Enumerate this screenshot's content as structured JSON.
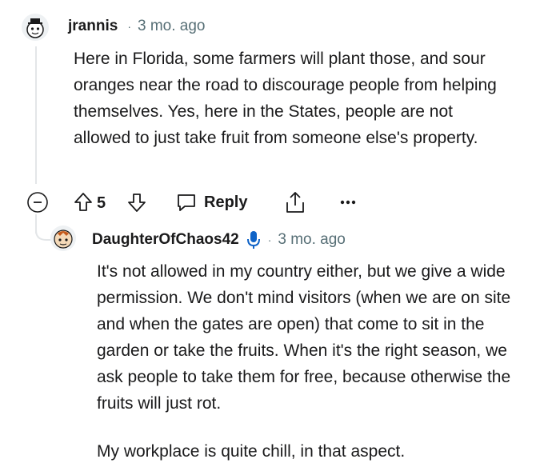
{
  "comments": [
    {
      "username": "jrannis",
      "time": "3 mo. ago",
      "body": [
        "Here in Florida, some farmers will plant those, and sour oranges near the road to discourage people from helping themselves. Yes, here in the States, people are not allowed to just take fruit from someone else's property."
      ],
      "score": "5",
      "reply_label": "Reply"
    },
    {
      "username": "DaughterOfChaos42",
      "time": "3 mo. ago",
      "body": [
        "It's not allowed in my country either, but we give a wide permission. We don't mind visitors (when we are on site and when the gates are open) that come to sit in the garden or take the fruits. When it's the right season, we ask people to take them for free, because otherwise the fruits will just rot.",
        "My workplace is quite chill, in that aspect."
      ]
    }
  ],
  "separator": "·",
  "icons": {
    "collapse": "collapse-icon",
    "upvote": "upvote-icon",
    "downvote": "downvote-icon",
    "reply": "reply-icon",
    "share": "share-icon",
    "more": "more-icon",
    "mic": "microphone-icon"
  },
  "colors": {
    "mic": "#0f63c7",
    "meta": "#576f76",
    "line": "#e3e6e8"
  }
}
